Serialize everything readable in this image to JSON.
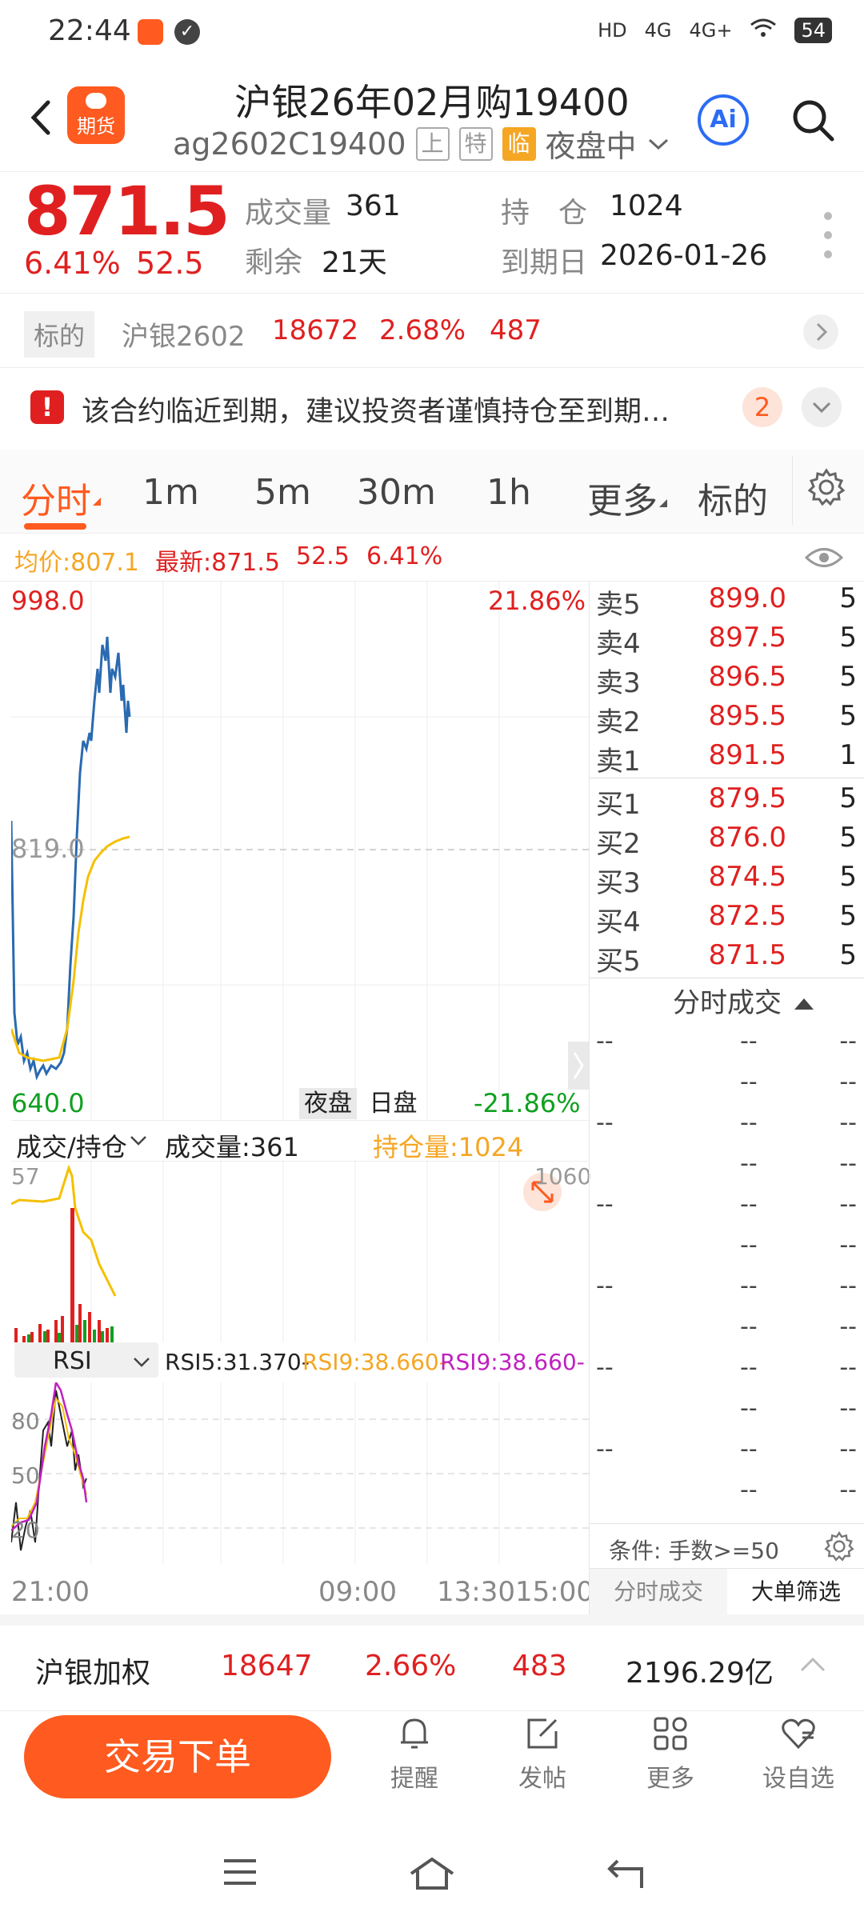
{
  "status_bar": {
    "time": "22:44",
    "network": "4G",
    "network2": "4G+",
    "battery": "54"
  },
  "header": {
    "logo_text": "期货",
    "title": "沪银26年02月购19400",
    "code": "ag2602C19400",
    "tags": [
      "上",
      "特",
      "临"
    ],
    "session": "夜盘中"
  },
  "quote": {
    "price": "871.5",
    "change_pct": "6.41%",
    "change": "52.5",
    "volume_label": "成交量",
    "volume": "361",
    "remaining_label": "剩余",
    "remaining": "21天",
    "position_label": "持　仓",
    "position": "1024",
    "expiry_label": "到期日",
    "expiry": "2026-01-26"
  },
  "underlying": {
    "label": "标的",
    "name": "沪银2602",
    "price": "18672",
    "pct": "2.68%",
    "change": "487"
  },
  "notice": {
    "text": "该合约临近到期，建议投资者谨慎持仓至到期…",
    "count": "2"
  },
  "tabs": [
    "分时",
    "1m",
    "5m",
    "30m",
    "1h",
    "更多",
    "标的"
  ],
  "indicators": {
    "avg": "均价:807.1",
    "latest": "最新:871.5",
    "change": "52.5",
    "pct": "6.41%"
  },
  "chart": {
    "y_high": "998.0",
    "y_mid": "819.0",
    "y_low": "640.0",
    "pct_high": "21.86%",
    "pct_low": "-21.86%",
    "sessions": [
      "夜盘",
      "日盘"
    ]
  },
  "volume_panel": {
    "selector": "成交/持仓",
    "volume": "成交量:361",
    "position": "持仓量:1024",
    "left_max": "57",
    "right_max": "1060"
  },
  "rsi_panel": {
    "selector": "RSI",
    "rsi5": "RSI5:31.370-",
    "rsi9a": "RSI9:38.660-",
    "rsi9b": "RSI9:38.660-",
    "levels": [
      "80",
      "50",
      "20"
    ]
  },
  "time_axis": [
    "21:00",
    "09:00",
    "13:30",
    "15:00"
  ],
  "orderbook": {
    "asks": [
      {
        "label": "卖5",
        "price": "899.0",
        "vol": "5"
      },
      {
        "label": "卖4",
        "price": "897.5",
        "vol": "5"
      },
      {
        "label": "卖3",
        "price": "896.5",
        "vol": "5"
      },
      {
        "label": "卖2",
        "price": "895.5",
        "vol": "5"
      },
      {
        "label": "卖1",
        "price": "891.5",
        "vol": "1"
      }
    ],
    "bids": [
      {
        "label": "买1",
        "price": "879.5",
        "vol": "5"
      },
      {
        "label": "买2",
        "price": "876.0",
        "vol": "5"
      },
      {
        "label": "买3",
        "price": "874.5",
        "vol": "5"
      },
      {
        "label": "买4",
        "price": "872.5",
        "vol": "5"
      },
      {
        "label": "买5",
        "price": "871.5",
        "vol": "5"
      }
    ],
    "ticks_title": "分时成交",
    "dash": "--",
    "condition": "条件: 手数>=50",
    "tab_ticks": "分时成交",
    "tab_big": "大单筛选"
  },
  "ticker": {
    "name": "沪银加权",
    "price": "18647",
    "pct": "2.66%",
    "change": "483",
    "amount": "2196.29亿"
  },
  "actions": {
    "trade": "交易下单",
    "remind": "提醒",
    "post": "发帖",
    "more": "更多",
    "watch": "设自选"
  },
  "colors": {
    "accent": "#ff5a1f",
    "up": "#e02020",
    "down": "#10a020",
    "price_line": "#2a6ab0",
    "avg_line": "#f5c000"
  }
}
